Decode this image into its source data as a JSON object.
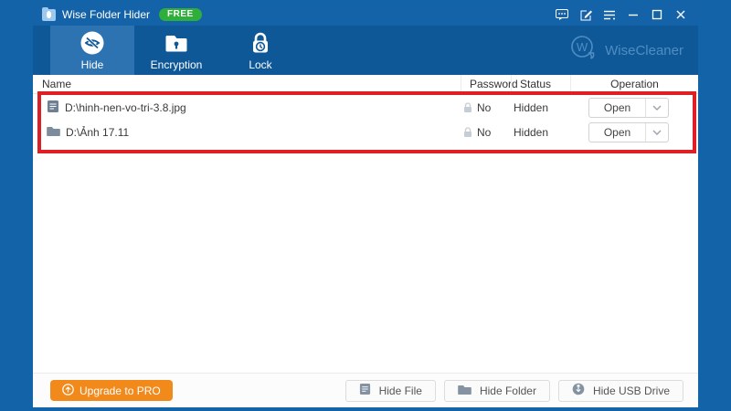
{
  "window": {
    "title": "Wise Folder Hider",
    "badge": "FREE",
    "titlebar_icons": [
      "feedback-icon",
      "edit-icon",
      "menu-icon",
      "minimize-icon",
      "maximize-icon",
      "close-icon"
    ]
  },
  "toolbar": {
    "tabs": [
      {
        "label": "Hide",
        "icon": "hide-eye-icon",
        "selected": true
      },
      {
        "label": "Encryption",
        "icon": "encryption-folder-icon",
        "selected": false
      },
      {
        "label": "Lock",
        "icon": "lock-clock-icon",
        "selected": false
      }
    ],
    "brand": {
      "icon": "wisecleaner-logo",
      "text": "WiseCleaner"
    }
  },
  "table": {
    "columns": {
      "name": "Name",
      "password": "Password",
      "status": "Status",
      "operation": "Operation"
    },
    "rows": [
      {
        "icon": "file-icon",
        "name": "D:\\hinh-nen-vo-tri-3.8.jpg",
        "password_icon": "lock-icon",
        "password": "No",
        "status": "Hidden",
        "operation": "Open"
      },
      {
        "icon": "folder-icon",
        "name": "D:\\Ảnh 17.11",
        "password_icon": "lock-icon",
        "password": "No",
        "status": "Hidden",
        "operation": "Open"
      }
    ],
    "highlight_color": "#de2026"
  },
  "footer": {
    "upgrade": {
      "icon": "upgrade-arrow-icon",
      "label": "Upgrade to PRO",
      "color": "#f28a1b"
    },
    "buttons": [
      {
        "icon": "file-icon",
        "label": "Hide File"
      },
      {
        "icon": "folder-icon",
        "label": "Hide Folder"
      },
      {
        "icon": "usb-icon",
        "label": "Hide USB Drive"
      }
    ]
  },
  "colors": {
    "titlebar": "#1463a9",
    "toolbar": "#0f5898",
    "selected_tab": "#2d72b1",
    "badge_green": "#2fae3b",
    "highlight_red": "#de2026",
    "upgrade_orange": "#f28a1b"
  }
}
